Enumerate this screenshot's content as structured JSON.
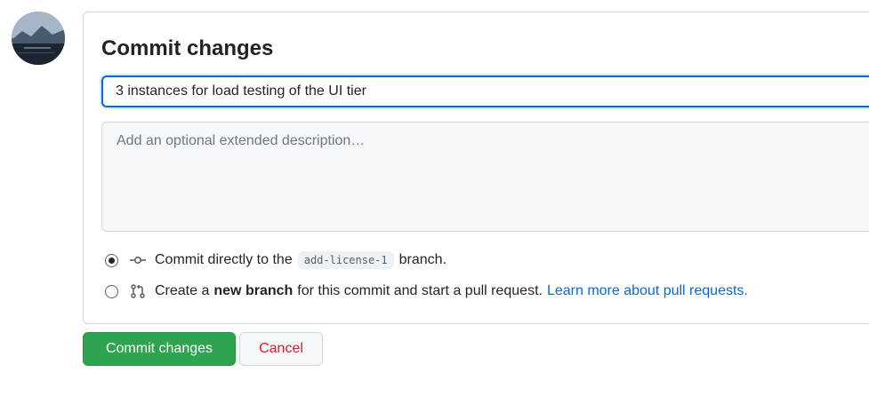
{
  "commit_form": {
    "title": "Commit changes",
    "summary_value": "3 instances for load testing of the UI tier",
    "description_placeholder": "Add an optional extended description…",
    "options": {
      "direct": {
        "selected": true,
        "prefix": "Commit directly to the",
        "branch": "add-license-1",
        "suffix": "branch."
      },
      "new_branch": {
        "selected": false,
        "prefix": "Create a",
        "bold": "new branch",
        "suffix": "for this commit and start a pull request.",
        "link": "Learn more about pull requests."
      }
    }
  },
  "actions": {
    "commit_label": "Commit changes",
    "cancel_label": "Cancel"
  },
  "colors": {
    "accent": "#0969da",
    "commit_button": "#2da44e",
    "cancel_text": "#cf222e"
  },
  "icons": {
    "direct": "git-commit-icon",
    "new_branch": "git-pull-request-icon"
  }
}
